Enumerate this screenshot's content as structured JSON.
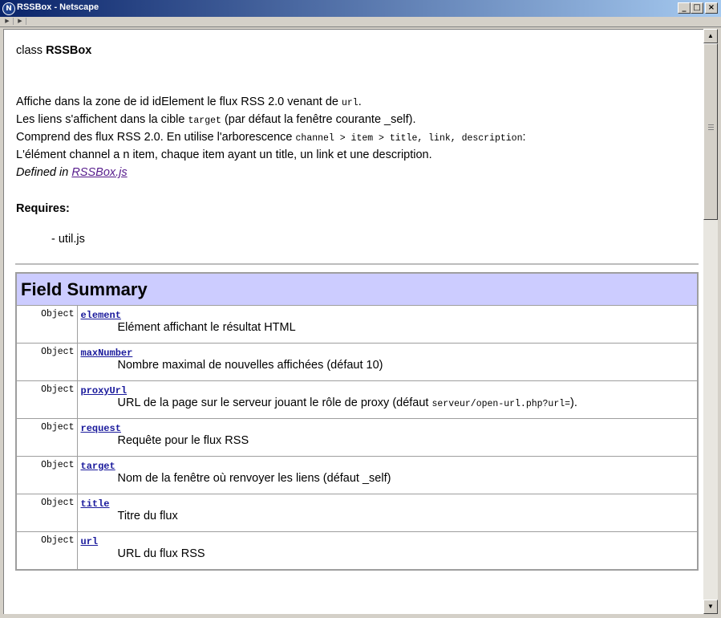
{
  "window": {
    "title": "RSSBox - Netscape",
    "app_icon_letter": "N",
    "minimize": "_",
    "maximize": "□",
    "close": "×"
  },
  "nav": {
    "back": "▶",
    "forward": "▶"
  },
  "doc": {
    "class_prefix": "class ",
    "class_name": "RSSBox",
    "line1_a": "Affiche dans la zone de id idElement le flux RSS 2.0 venant de ",
    "line1_code": "url",
    "line1_b": ".",
    "line2_a": "Les liens s'affichent dans la cible ",
    "line2_code": "target",
    "line2_b": " (par défaut la fenêtre courante _self).",
    "line3_a": "Comprend des flux RSS 2.0. En utilise l'arborescence ",
    "line3_code": "channel > item > title, link, description",
    "line3_b": ":",
    "line4": "L'élément channel a n item, chaque item ayant un title, un link et une description.",
    "defined_in": "Defined in ",
    "defined_link": "RSSBox.js",
    "requires_label": "Requires:",
    "requires_item": "- util.js"
  },
  "field_summary": {
    "heading": "Field Summary",
    "rows": [
      {
        "type": "Object",
        "name": "element",
        "desc": "Elément affichant le résultat HTML"
      },
      {
        "type": "Object",
        "name": "maxNumber",
        "desc": "Nombre maximal de nouvelles affichées (défaut 10)"
      },
      {
        "type": "Object",
        "name": "proxyUrl",
        "desc": "URL de la page sur le serveur jouant le rôle de proxy (défaut ",
        "desc_code": "serveur/open-url.php?url=",
        "desc_end": ")."
      },
      {
        "type": "Object",
        "name": "request",
        "desc": "Requête pour le flux RSS"
      },
      {
        "type": "Object",
        "name": "target",
        "desc": "Nom de la fenêtre où renvoyer les liens (défaut _self)"
      },
      {
        "type": "Object",
        "name": "title",
        "desc": "Titre du flux"
      },
      {
        "type": "Object",
        "name": "url",
        "desc": "URL du flux RSS"
      }
    ]
  },
  "scrollbar": {
    "up": "▲",
    "down": "▼"
  }
}
